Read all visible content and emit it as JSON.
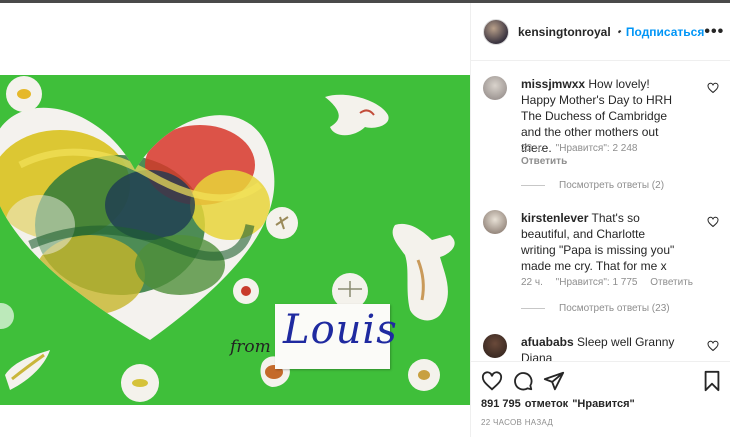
{
  "post": {
    "username": "kensingtonroyal",
    "follow_label": "Подписаться",
    "dot": "•",
    "more_label": "•••",
    "artwork": {
      "from_text": "from",
      "name_text": "Louis"
    }
  },
  "comments": [
    {
      "username": "missjmwxx",
      "text": "How lovely! Happy Mother's Day to HRH The Duchess of Cambridge and the other mothers out there.",
      "time": "22 ч.",
      "likes": "\"Нравится\": 2 248",
      "reply": "Ответить",
      "view_replies": "Посмотреть ответы (2)"
    },
    {
      "username": "kirstenlever",
      "text": "That's so beautiful, and Charlotte writing \"Papa is missing you\" made me cry. That for me x",
      "time": "22 ч.",
      "likes": "\"Нравится\": 1 775",
      "reply": "Ответить",
      "view_replies": "Посмотреть ответы (23)"
    },
    {
      "username": "afuababs",
      "text": "Sleep well Granny Diana"
    }
  ],
  "footer": {
    "likes_count": "891 795",
    "likes_word": "отметок",
    "likes_suffix": "\"Нравится\"",
    "timestamp": "22 ЧАСОВ НАЗАД"
  },
  "colors": {
    "background_green": "#3fbf3a",
    "link_blue": "#0095f6",
    "verified_blue": "#3897f0"
  }
}
